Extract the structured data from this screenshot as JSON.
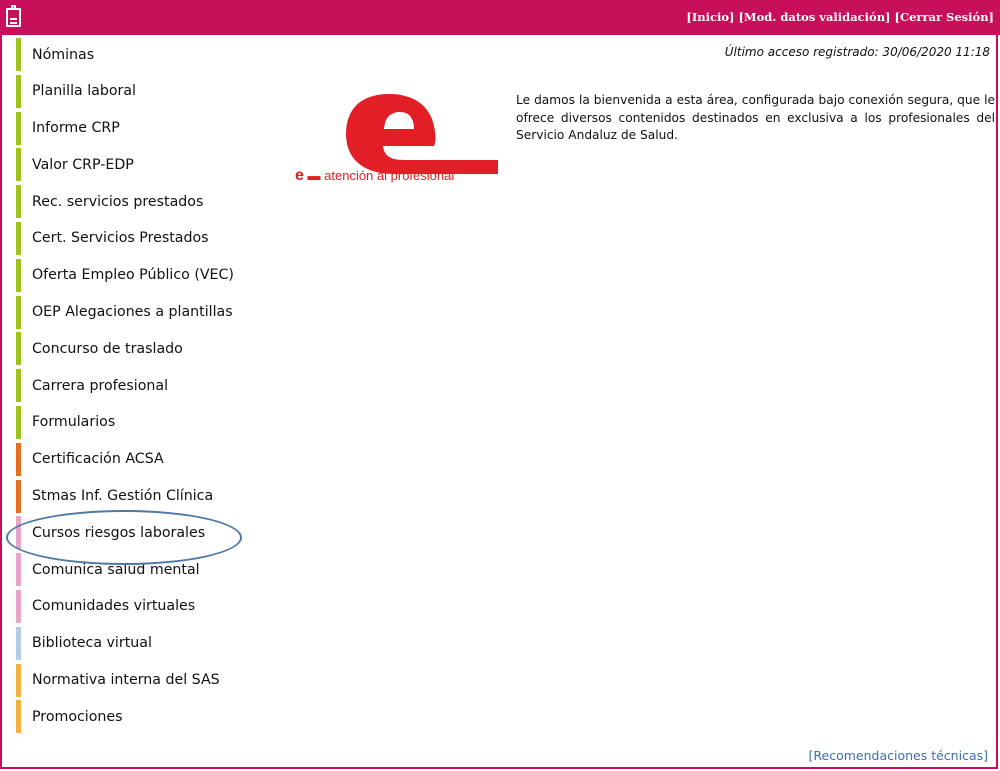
{
  "header": {
    "links": [
      "[Inicio]",
      "[Mod. datos validación]",
      "[Cerrar Sesión]"
    ]
  },
  "last_access": "Último acceso registrado: 30/06/2020 11:18",
  "menu": {
    "items": [
      {
        "label": "Nóminas",
        "color": "#9dc21a"
      },
      {
        "label": "Planilla laboral",
        "color": "#9dc21a"
      },
      {
        "label": "Informe CRP",
        "color": "#9dc21a"
      },
      {
        "label": "Valor CRP-EDP",
        "color": "#9dc21a"
      },
      {
        "label": "Rec. servicios prestados",
        "color": "#9dc21a"
      },
      {
        "label": "Cert. Servicios Prestados",
        "color": "#9dc21a"
      },
      {
        "label": "Oferta Empleo Público (VEC)",
        "color": "#9dc21a"
      },
      {
        "label": "OEP Alegaciones a plantillas",
        "color": "#9dc21a"
      },
      {
        "label": "Concurso de traslado",
        "color": "#9dc21a"
      },
      {
        "label": "Carrera profesional",
        "color": "#9dc21a"
      },
      {
        "label": "Formularios",
        "color": "#9dc21a"
      },
      {
        "label": "Certificación ACSA",
        "color": "#e56f1e"
      },
      {
        "label": "Stmas Inf. Gestión Clínica",
        "color": "#e56f1e"
      },
      {
        "label": "Cursos riesgos laborales",
        "color": "#e6a7c7"
      },
      {
        "label": "Comunica salud mental",
        "color": "#e6a7c7"
      },
      {
        "label": "Comunidades virtuales",
        "color": "#e6a7c7"
      },
      {
        "label": "Biblioteca virtual",
        "color": "#b3cde3"
      },
      {
        "label": "Normativa interna del SAS",
        "color": "#f3b13d"
      },
      {
        "label": "Promociones",
        "color": "#f3b13d"
      }
    ]
  },
  "logo": {
    "letter": "e",
    "tagline": "atención al profesional"
  },
  "welcome_text": "Le damos la bienvenida a esta área, configurada bajo conexión segura, que le ofrece diversos contenidos destinados en exclusiva a los profesionales del Servicio Andaluz de Salud.",
  "footer": {
    "link": "[Recomendaciones técnicas]"
  },
  "colors": {
    "brand": "#c8105a",
    "logo_red": "#e21f26",
    "highlight": "#4e79a6"
  }
}
